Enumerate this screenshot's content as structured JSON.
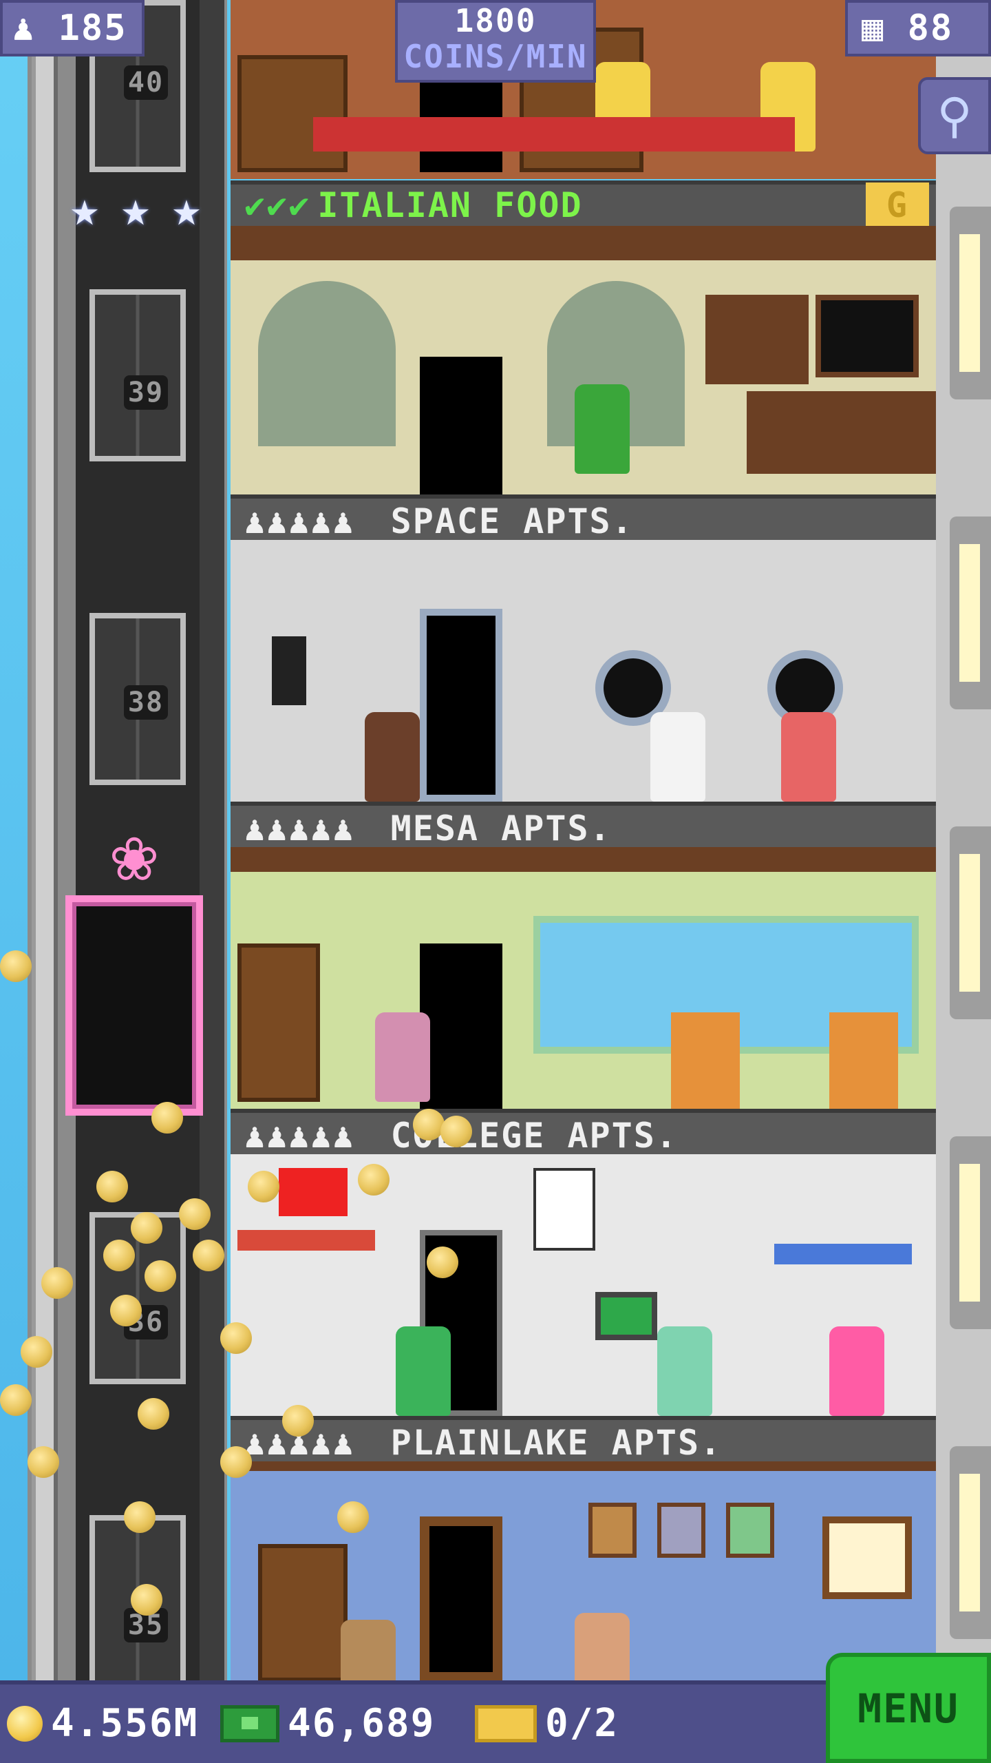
{
  "hud": {
    "population": "185",
    "coins_per_min_value": "1800",
    "coins_per_min_label": "COINS/MIN",
    "floor_count": "88"
  },
  "elevator": {
    "floors": [
      "40",
      "39",
      "38",
      "36",
      "35"
    ],
    "stars": 3
  },
  "floors": [
    {
      "name": "ITALIAN FOOD",
      "type": "food",
      "checks": "✔✔✔",
      "badge": "G"
    },
    {
      "name": "SPACE APTS.",
      "type": "residential",
      "residents": "♟♟♟♟♟"
    },
    {
      "name": "MESA APTS.",
      "type": "residential",
      "residents": "♟♟♟♟♟"
    },
    {
      "name": "COLLEGE APTS.",
      "type": "residential",
      "residents": "♟♟♟♟♟"
    },
    {
      "name": "PLAINLAKE APTS.",
      "type": "residential",
      "residents": "♟♟♟♟♟"
    }
  ],
  "bottom_bar": {
    "coins": "4.556M",
    "bux": "46,689",
    "tickets": "0/2",
    "menu_label": "MENU"
  },
  "colors": {
    "accent": "#6d6ba8",
    "menu_green": "#2fc43b",
    "food_label": "#7df34a"
  }
}
